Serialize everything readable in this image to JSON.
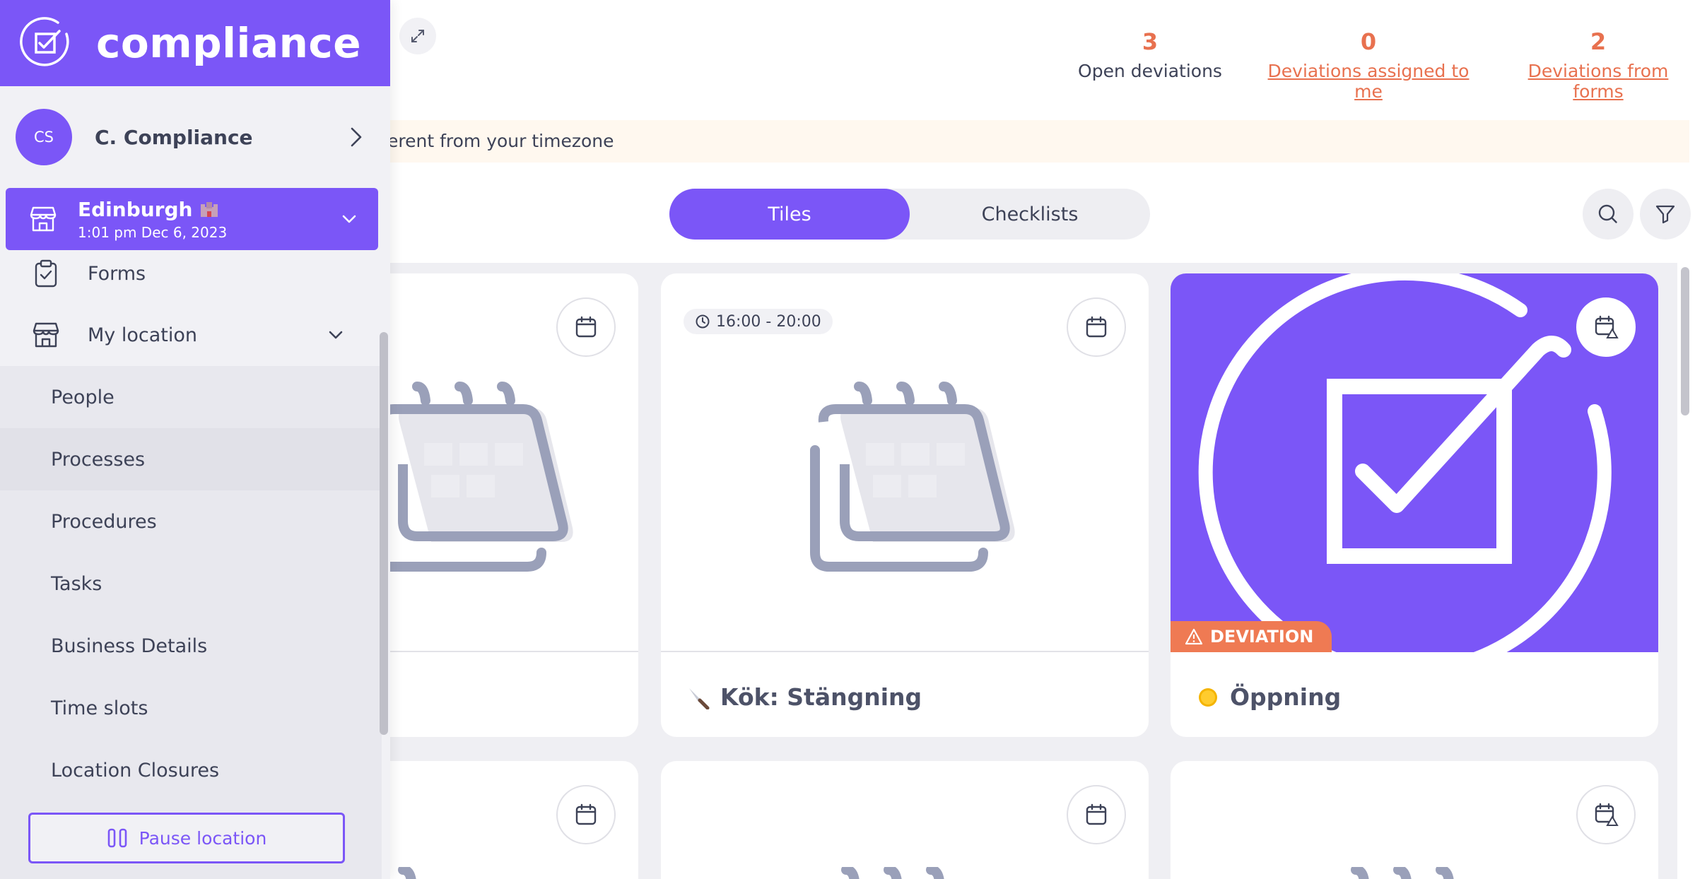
{
  "app": {
    "logo_text": "compliance"
  },
  "user": {
    "initials": "CS",
    "name": "C. Compliance"
  },
  "location": {
    "name": "Edinburgh",
    "flag_icon": "castle-icon",
    "datetime": "1:01 pm Dec 6, 2023"
  },
  "nav": {
    "forms_label": "Forms",
    "my_location_label": "My location",
    "sub_items": [
      {
        "label": "People"
      },
      {
        "label": "Processes"
      },
      {
        "label": "Procedures"
      },
      {
        "label": "Tasks"
      },
      {
        "label": "Business Details"
      },
      {
        "label": "Time slots"
      },
      {
        "label": "Location Closures"
      }
    ],
    "pause_label": "Pause location"
  },
  "stats": [
    {
      "value": "3",
      "label": "Open deviations"
    },
    {
      "value": "0",
      "label": "Deviations assigned to me"
    },
    {
      "value": "2",
      "label": "Deviations from forms"
    }
  ],
  "banner": {
    "text": "erent from your timezone"
  },
  "view_toggle": {
    "tiles_label": "Tiles",
    "checklists_label": "Checklists",
    "active": "Tiles"
  },
  "cards": [
    {
      "title": "",
      "time": ""
    },
    {
      "title": "Kök: Stängning",
      "time": "16:00 - 20:00",
      "title_icon": "knife-icon"
    },
    {
      "title": "Öppning",
      "badge": "DEVIATION",
      "title_icon": "sun-icon"
    }
  ],
  "colors": {
    "accent": "#7b56f7",
    "warning": "#e8714f",
    "badge": "#ef7a53"
  }
}
